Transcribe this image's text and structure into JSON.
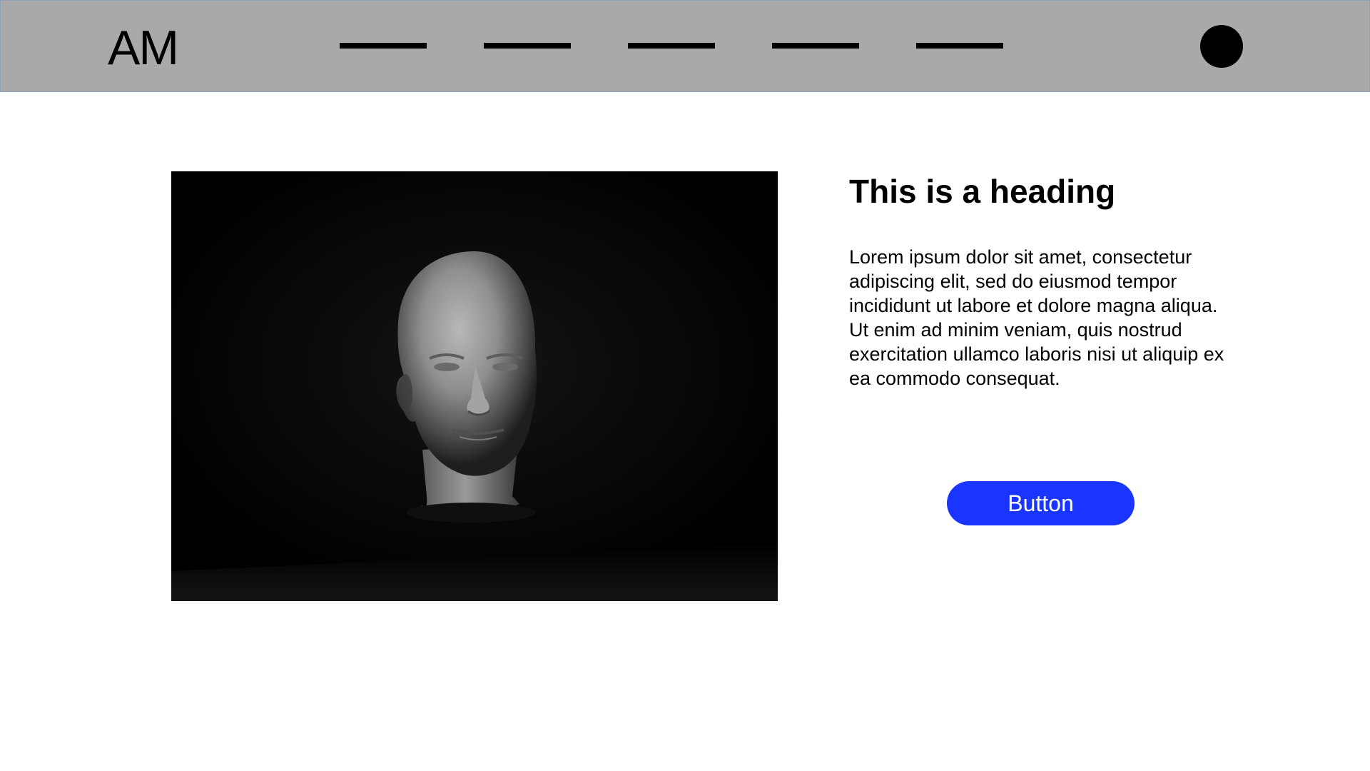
{
  "header": {
    "logo_text": "AM",
    "nav_items": [
      "",
      "",
      "",
      "",
      ""
    ],
    "avatar_icon": "user-avatar-icon"
  },
  "main": {
    "image": {
      "subject": "mannequin-head-icon"
    },
    "heading": "This is a heading",
    "body": "Lorem ipsum dolor sit amet, consectetur adipiscing elit, sed do eiusmod tempor incididunt ut labore et dolore magna aliqua. Ut enim ad minim veniam, quis nostrud exercitation ullamco laboris nisi ut aliquip ex ea commodo consequat.",
    "button_label": "Button"
  },
  "colors": {
    "header_bg": "#a9a9a9",
    "button_bg": "#1a35ff",
    "button_text": "#ffffff",
    "text": "#000000"
  }
}
